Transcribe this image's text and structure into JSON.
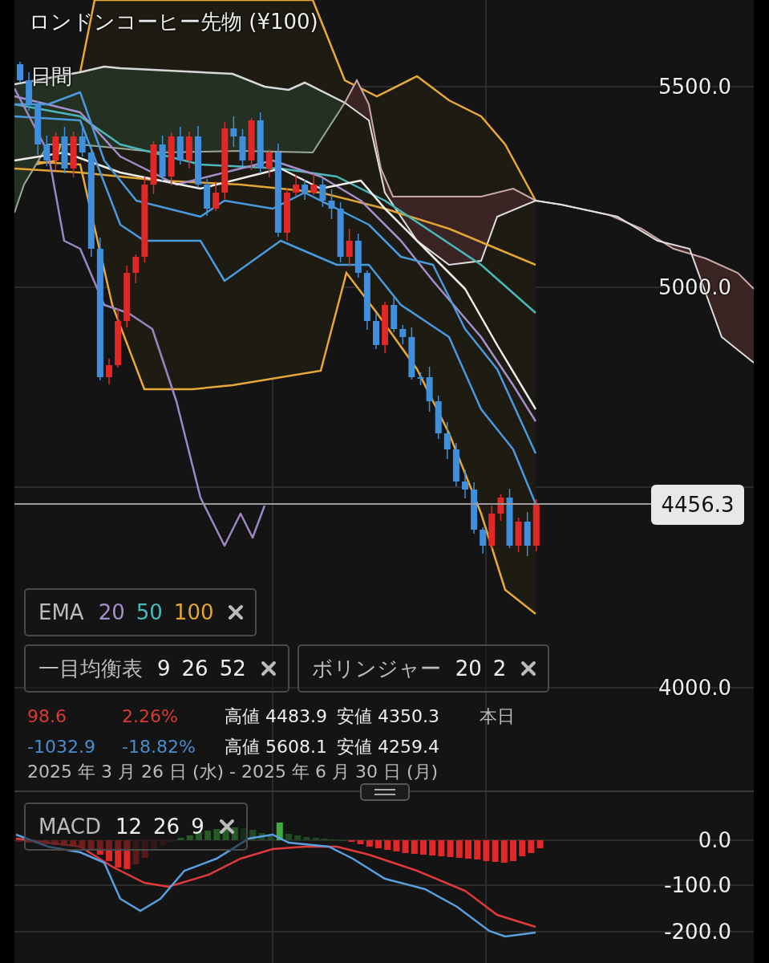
{
  "header": {
    "title": "ロンドンコーヒー先物 (¥100)",
    "period": "日間"
  },
  "price_axis": {
    "labels": [
      "5500.0",
      "5000.0",
      "4000.0"
    ]
  },
  "price_badge": "4456.3",
  "indicators": [
    {
      "label": "EMA",
      "params": [
        {
          "text": "20",
          "color": "#a48fcc"
        },
        {
          "text": "50",
          "color": "#4cb8bc"
        },
        {
          "text": "100",
          "color": "#e2a434"
        }
      ]
    },
    {
      "label": "一目均衡表",
      "params": [
        {
          "text": "9"
        },
        {
          "text": "26"
        },
        {
          "text": "52"
        }
      ]
    },
    {
      "label": "ボリンジャー",
      "params": [
        {
          "text": "20"
        },
        {
          "text": "2"
        }
      ]
    }
  ],
  "stats": [
    {
      "change": "98.6",
      "change_pct": "2.26%",
      "color": "#d83a34",
      "high": "高値 4483.9",
      "low": "安値 4350.3",
      "period": "本日"
    },
    {
      "change": "-1032.9",
      "change_pct": "-18.82%",
      "color": "#4a8ccc",
      "high": "高値 5608.1",
      "low": "安値 4259.4"
    }
  ],
  "date_range": "2025 年 3 月 26 日 (水) - 2025 年 6 月 30 日 (月)",
  "macd": {
    "legend": {
      "label": "MACD",
      "params": [
        {
          "text": "12"
        },
        {
          "text": "26"
        },
        {
          "text": "9"
        }
      ]
    },
    "axis_labels": [
      "0.0",
      "-100.0",
      "-200.0"
    ]
  }
}
